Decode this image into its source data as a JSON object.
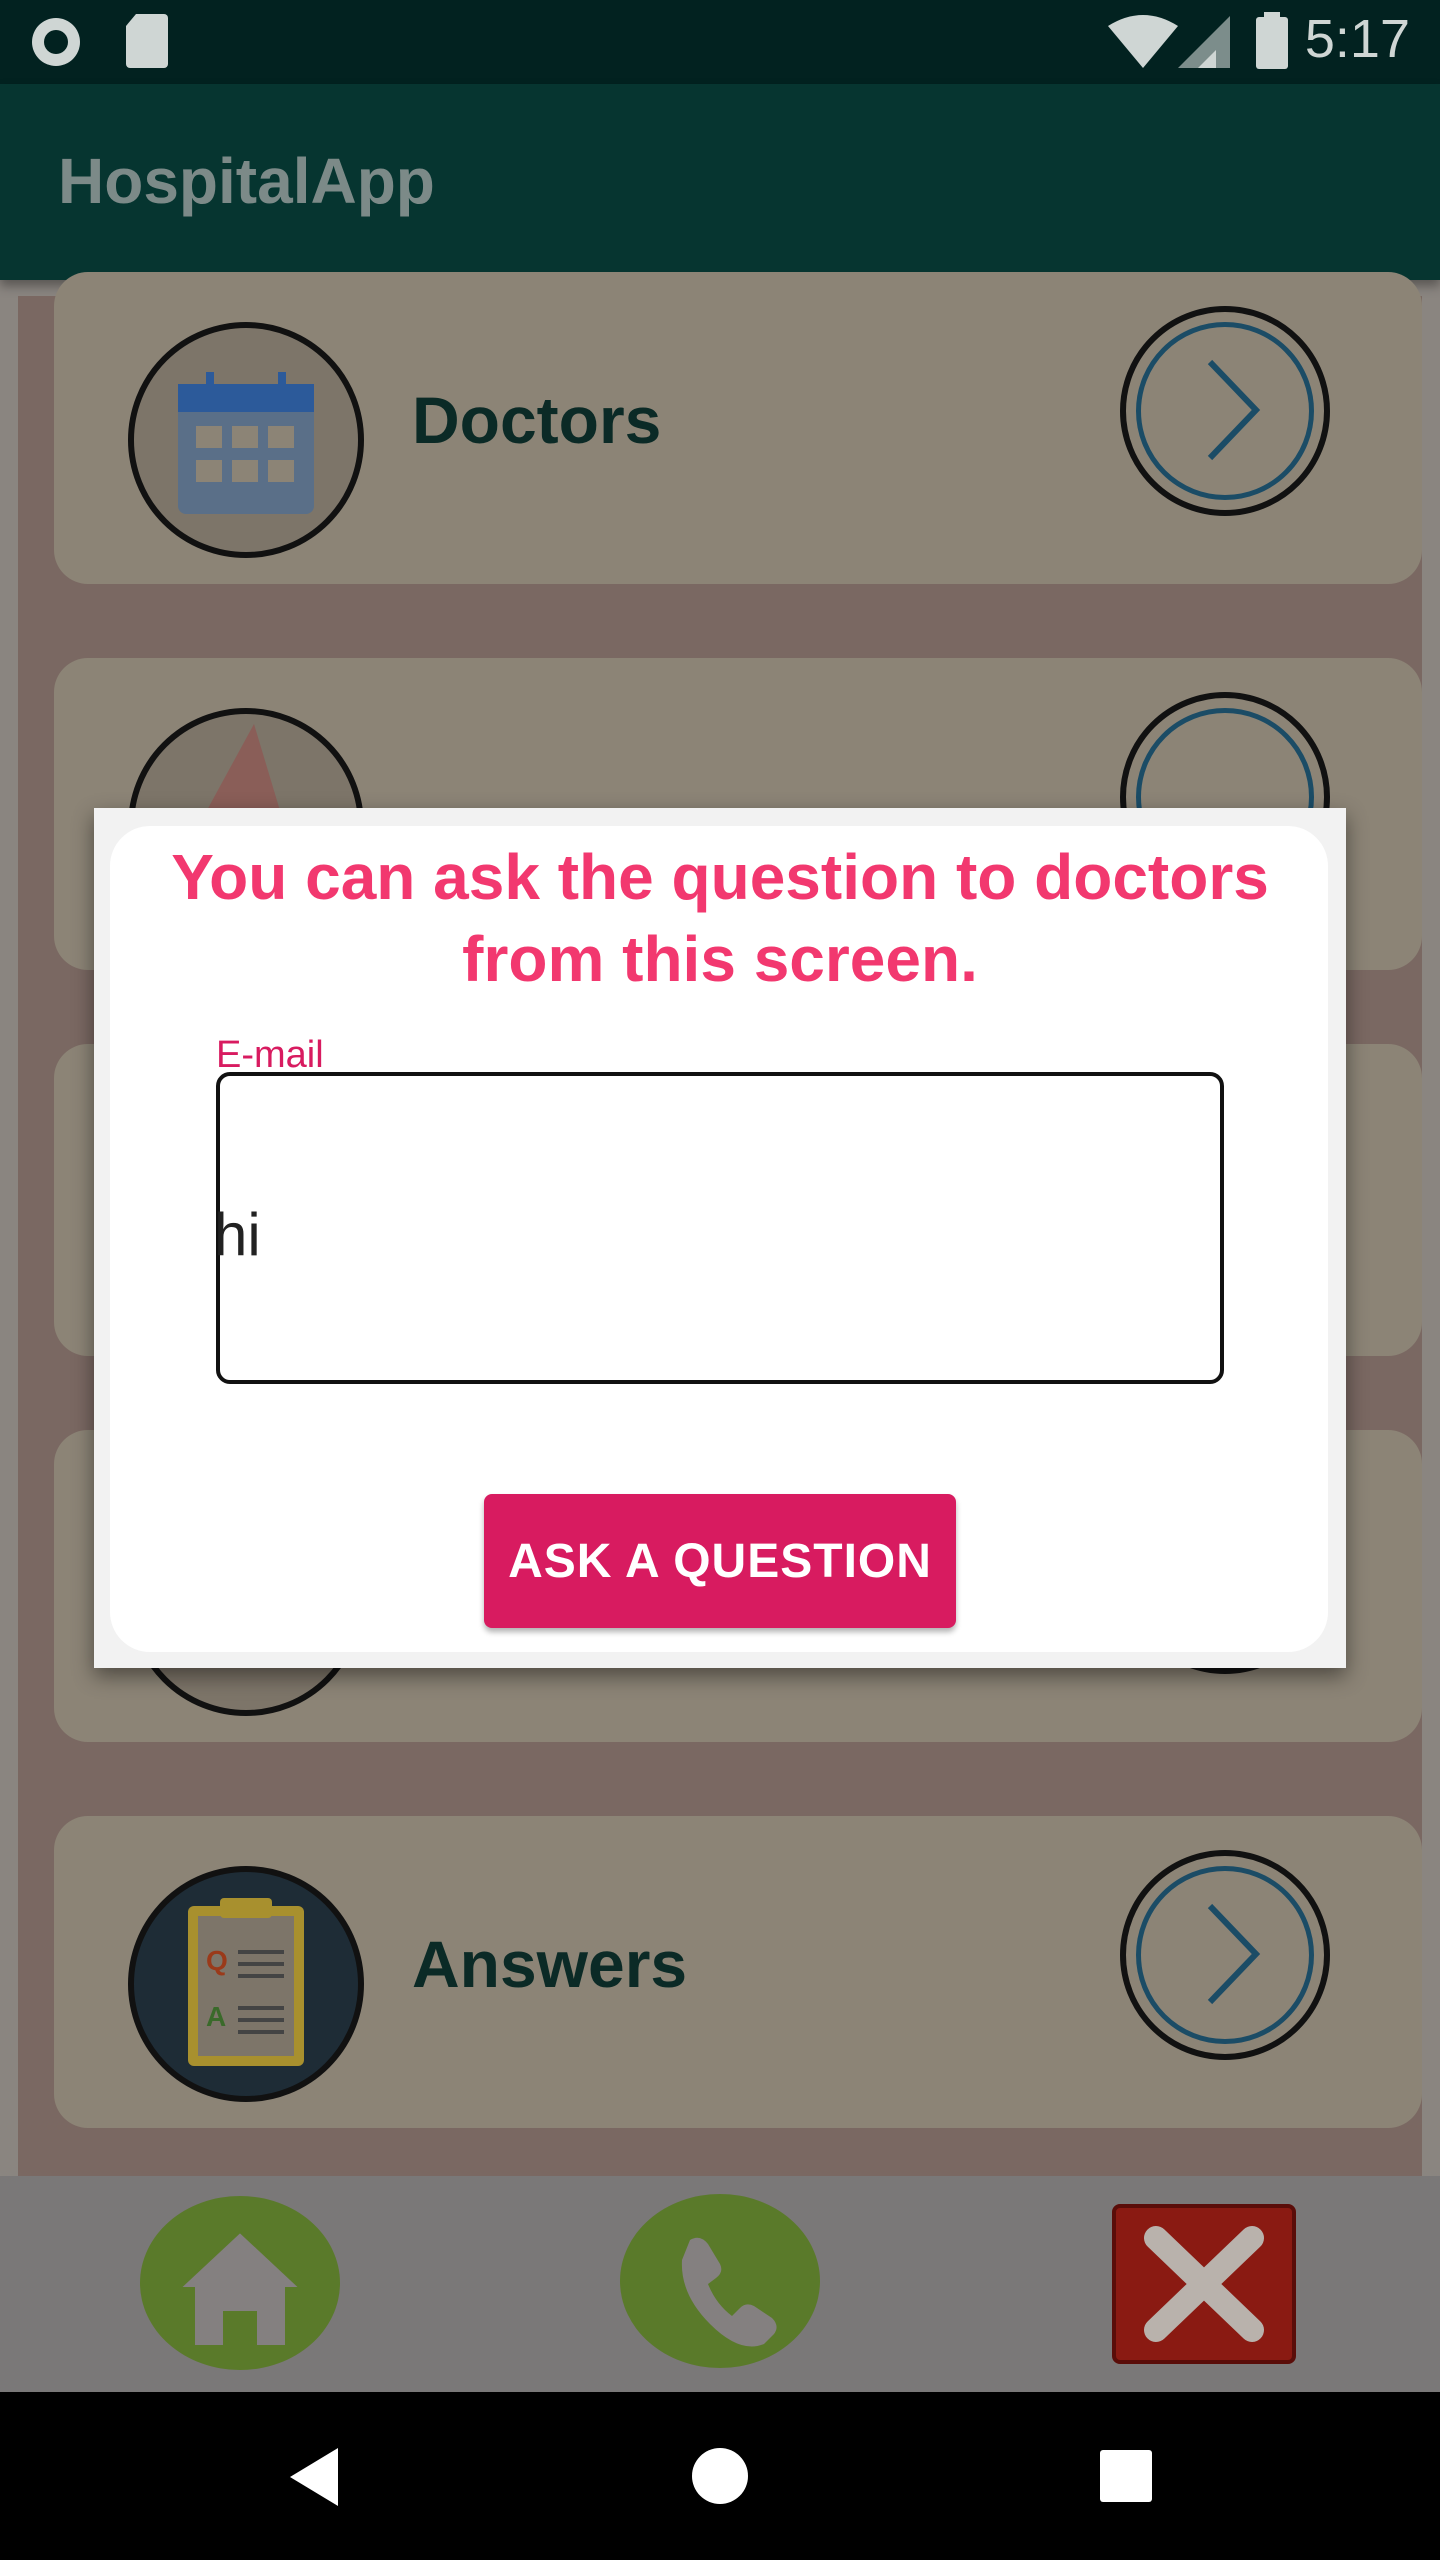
{
  "status_bar": {
    "time": "5:17"
  },
  "app_bar": {
    "title": "HospitalApp"
  },
  "list": {
    "items": [
      {
        "label": "Doctors",
        "icon": "calendar-icon"
      },
      {
        "label": "",
        "icon": "megaphone-icon"
      },
      {
        "label": "",
        "icon": "unknown-icon"
      },
      {
        "label": "",
        "icon": "unknown-icon"
      },
      {
        "label": "Answers",
        "icon": "clipboard-qa-icon"
      }
    ]
  },
  "bottom_nav": {
    "home_icon": "home-icon",
    "call_icon": "phone-icon",
    "close_icon": "close-icon"
  },
  "dialog": {
    "title": "You can ask the question to doctors from this screen.",
    "email_label": "E-mail",
    "email_value": "hi",
    "button_label": "ASK A QUESTION"
  },
  "colors": {
    "accent": "#d81b60",
    "title_pink": "#f2386f",
    "app_bar": "#063530"
  }
}
